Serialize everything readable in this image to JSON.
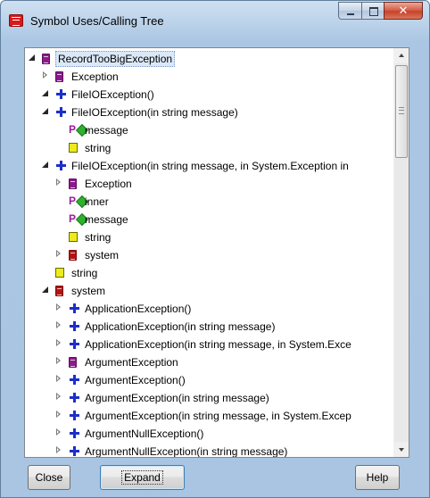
{
  "window": {
    "title": "Symbol Uses/Calling Tree"
  },
  "tree": {
    "rows": [
      {
        "label": "RecordTooBigException",
        "indent": 0,
        "expander": "open",
        "icon": "class-purple",
        "selected": true
      },
      {
        "label": "Exception",
        "indent": 1,
        "expander": "closed",
        "icon": "class-purple"
      },
      {
        "label": "FileIOException()",
        "indent": 1,
        "expander": "open",
        "icon": "method"
      },
      {
        "label": "FileIOException(in string message)",
        "indent": 1,
        "expander": "open",
        "icon": "method"
      },
      {
        "label": "message",
        "indent": 2,
        "expander": "none",
        "icon": "param"
      },
      {
        "label": "string",
        "indent": 2,
        "expander": "none",
        "icon": "type"
      },
      {
        "label": "FileIOException(in string message, in System.Exception in",
        "indent": 1,
        "expander": "open",
        "icon": "method"
      },
      {
        "label": "Exception",
        "indent": 2,
        "expander": "closed",
        "icon": "class-purple"
      },
      {
        "label": "inner",
        "indent": 2,
        "expander": "none",
        "icon": "param"
      },
      {
        "label": "message",
        "indent": 2,
        "expander": "none",
        "icon": "param"
      },
      {
        "label": "string",
        "indent": 2,
        "expander": "none",
        "icon": "type"
      },
      {
        "label": "system",
        "indent": 2,
        "expander": "closed",
        "icon": "class-red"
      },
      {
        "label": "string",
        "indent": 1,
        "expander": "none",
        "icon": "type"
      },
      {
        "label": "system",
        "indent": 1,
        "expander": "open",
        "icon": "class-red"
      },
      {
        "label": "ApplicationException()",
        "indent": 2,
        "expander": "closed",
        "icon": "method"
      },
      {
        "label": "ApplicationException(in string message)",
        "indent": 2,
        "expander": "closed",
        "icon": "method"
      },
      {
        "label": "ApplicationException(in string message, in System.Exce",
        "indent": 2,
        "expander": "closed",
        "icon": "method"
      },
      {
        "label": "ArgumentException",
        "indent": 2,
        "expander": "closed",
        "icon": "class-purple"
      },
      {
        "label": "ArgumentException()",
        "indent": 2,
        "expander": "closed",
        "icon": "method"
      },
      {
        "label": "ArgumentException(in string message)",
        "indent": 2,
        "expander": "closed",
        "icon": "method"
      },
      {
        "label": "ArgumentException(in string message, in System.Excep",
        "indent": 2,
        "expander": "closed",
        "icon": "method"
      },
      {
        "label": "ArgumentNullException()",
        "indent": 2,
        "expander": "closed",
        "icon": "method"
      },
      {
        "label": "ArgumentNullException(in string message)",
        "indent": 2,
        "expander": "closed",
        "icon": "method"
      }
    ]
  },
  "buttons": {
    "close": "Close",
    "expand": "Expand",
    "help": "Help"
  }
}
